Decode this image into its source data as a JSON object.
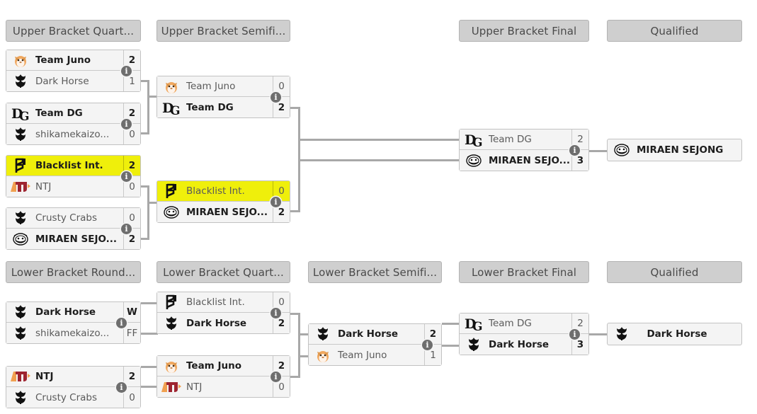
{
  "page": {
    "title": "Tournament Bracket",
    "colors": {
      "highlight": "#efef0b",
      "header_bg": "#cfcfcf",
      "box_bg": "#f4f4f4",
      "connector": "#a8a8a8",
      "win_text": "#1d1d1d",
      "lose_text": "#5a5a5a"
    },
    "info_badge_label": "i"
  },
  "rounds": [
    {
      "id": "ubqf",
      "label": "Upper Bracket Quart..."
    },
    {
      "id": "ubsf",
      "label": "Upper Bracket Semifi..."
    },
    {
      "id": "ubf",
      "label": "Upper Bracket Final"
    },
    {
      "id": "ubq",
      "label": "Qualified"
    },
    {
      "id": "lbr1",
      "label": "Lower Bracket Round..."
    },
    {
      "id": "lbqf",
      "label": "Lower Bracket Quart..."
    },
    {
      "id": "lbsf",
      "label": "Lower Bracket Semifi..."
    },
    {
      "id": "lbf",
      "label": "Lower Bracket Final"
    },
    {
      "id": "lbq",
      "label": "Qualified"
    }
  ],
  "matches": {
    "ubqf1": {
      "top": {
        "name": "Team Juno",
        "score": "2",
        "logo": "juno",
        "winner": true
      },
      "bottom": {
        "name": "Dark Horse",
        "score": "1",
        "logo": "horse",
        "winner": false
      }
    },
    "ubqf2": {
      "top": {
        "name": "Team DG",
        "score": "2",
        "logo": "dg",
        "winner": true
      },
      "bottom": {
        "name": "shikamekaizo...",
        "score": "0",
        "logo": "horse",
        "winner": false
      }
    },
    "ubqf3": {
      "top": {
        "name": "Blacklist Int.",
        "score": "2",
        "logo": "blacklist",
        "winner": true,
        "highlight": true
      },
      "bottom": {
        "name": "NTJ",
        "score": "0",
        "logo": "ntj",
        "winner": false
      }
    },
    "ubqf4": {
      "top": {
        "name": "Crusty Crabs",
        "score": "0",
        "logo": "horse",
        "winner": false
      },
      "bottom": {
        "name": "MIRAEN SEJO...",
        "score": "2",
        "logo": "miraen",
        "winner": true
      }
    },
    "ubsf1": {
      "top": {
        "name": "Team Juno",
        "score": "0",
        "logo": "juno",
        "winner": false
      },
      "bottom": {
        "name": "Team DG",
        "score": "2",
        "logo": "dg",
        "winner": true
      }
    },
    "ubsf2": {
      "top": {
        "name": "Blacklist Int.",
        "score": "0",
        "logo": "blacklist",
        "winner": false,
        "highlight": true
      },
      "bottom": {
        "name": "MIRAEN SEJO...",
        "score": "2",
        "logo": "miraen",
        "winner": true
      }
    },
    "ubf1": {
      "top": {
        "name": "Team DG",
        "score": "2",
        "logo": "dg",
        "winner": false
      },
      "bottom": {
        "name": "MIRAEN SEJO...",
        "score": "3",
        "logo": "miraen",
        "winner": true
      }
    },
    "ubqualified": {
      "slot": {
        "name": "MIRAEN SEJONG",
        "logo": "miraen",
        "winner": true
      }
    },
    "lbr1a": {
      "top": {
        "name": "Dark Horse",
        "score": "W",
        "logo": "horse",
        "winner": true
      },
      "bottom": {
        "name": "shikamekaizo...",
        "score": "FF",
        "logo": "horse",
        "winner": false
      }
    },
    "lbr1b": {
      "top": {
        "name": "NTJ",
        "score": "2",
        "logo": "ntj",
        "winner": true
      },
      "bottom": {
        "name": "Crusty Crabs",
        "score": "0",
        "logo": "horse",
        "winner": false
      }
    },
    "lbqf1": {
      "top": {
        "name": "Blacklist Int.",
        "score": "0",
        "logo": "blacklist",
        "winner": false
      },
      "bottom": {
        "name": "Dark Horse",
        "score": "2",
        "logo": "horse",
        "winner": true
      }
    },
    "lbqf2": {
      "top": {
        "name": "Team Juno",
        "score": "2",
        "logo": "juno",
        "winner": true
      },
      "bottom": {
        "name": "NTJ",
        "score": "0",
        "logo": "ntj",
        "winner": false
      }
    },
    "lbsf1": {
      "top": {
        "name": "Dark Horse",
        "score": "2",
        "logo": "horse",
        "winner": true
      },
      "bottom": {
        "name": "Team Juno",
        "score": "1",
        "logo": "juno",
        "winner": false
      }
    },
    "lbf1": {
      "top": {
        "name": "Team DG",
        "score": "2",
        "logo": "dg",
        "winner": false
      },
      "bottom": {
        "name": "Dark Horse",
        "score": "3",
        "logo": "horse",
        "winner": true
      }
    },
    "lbqualified": {
      "slot": {
        "name": "Dark Horse",
        "logo": "horse",
        "winner": true
      }
    }
  }
}
